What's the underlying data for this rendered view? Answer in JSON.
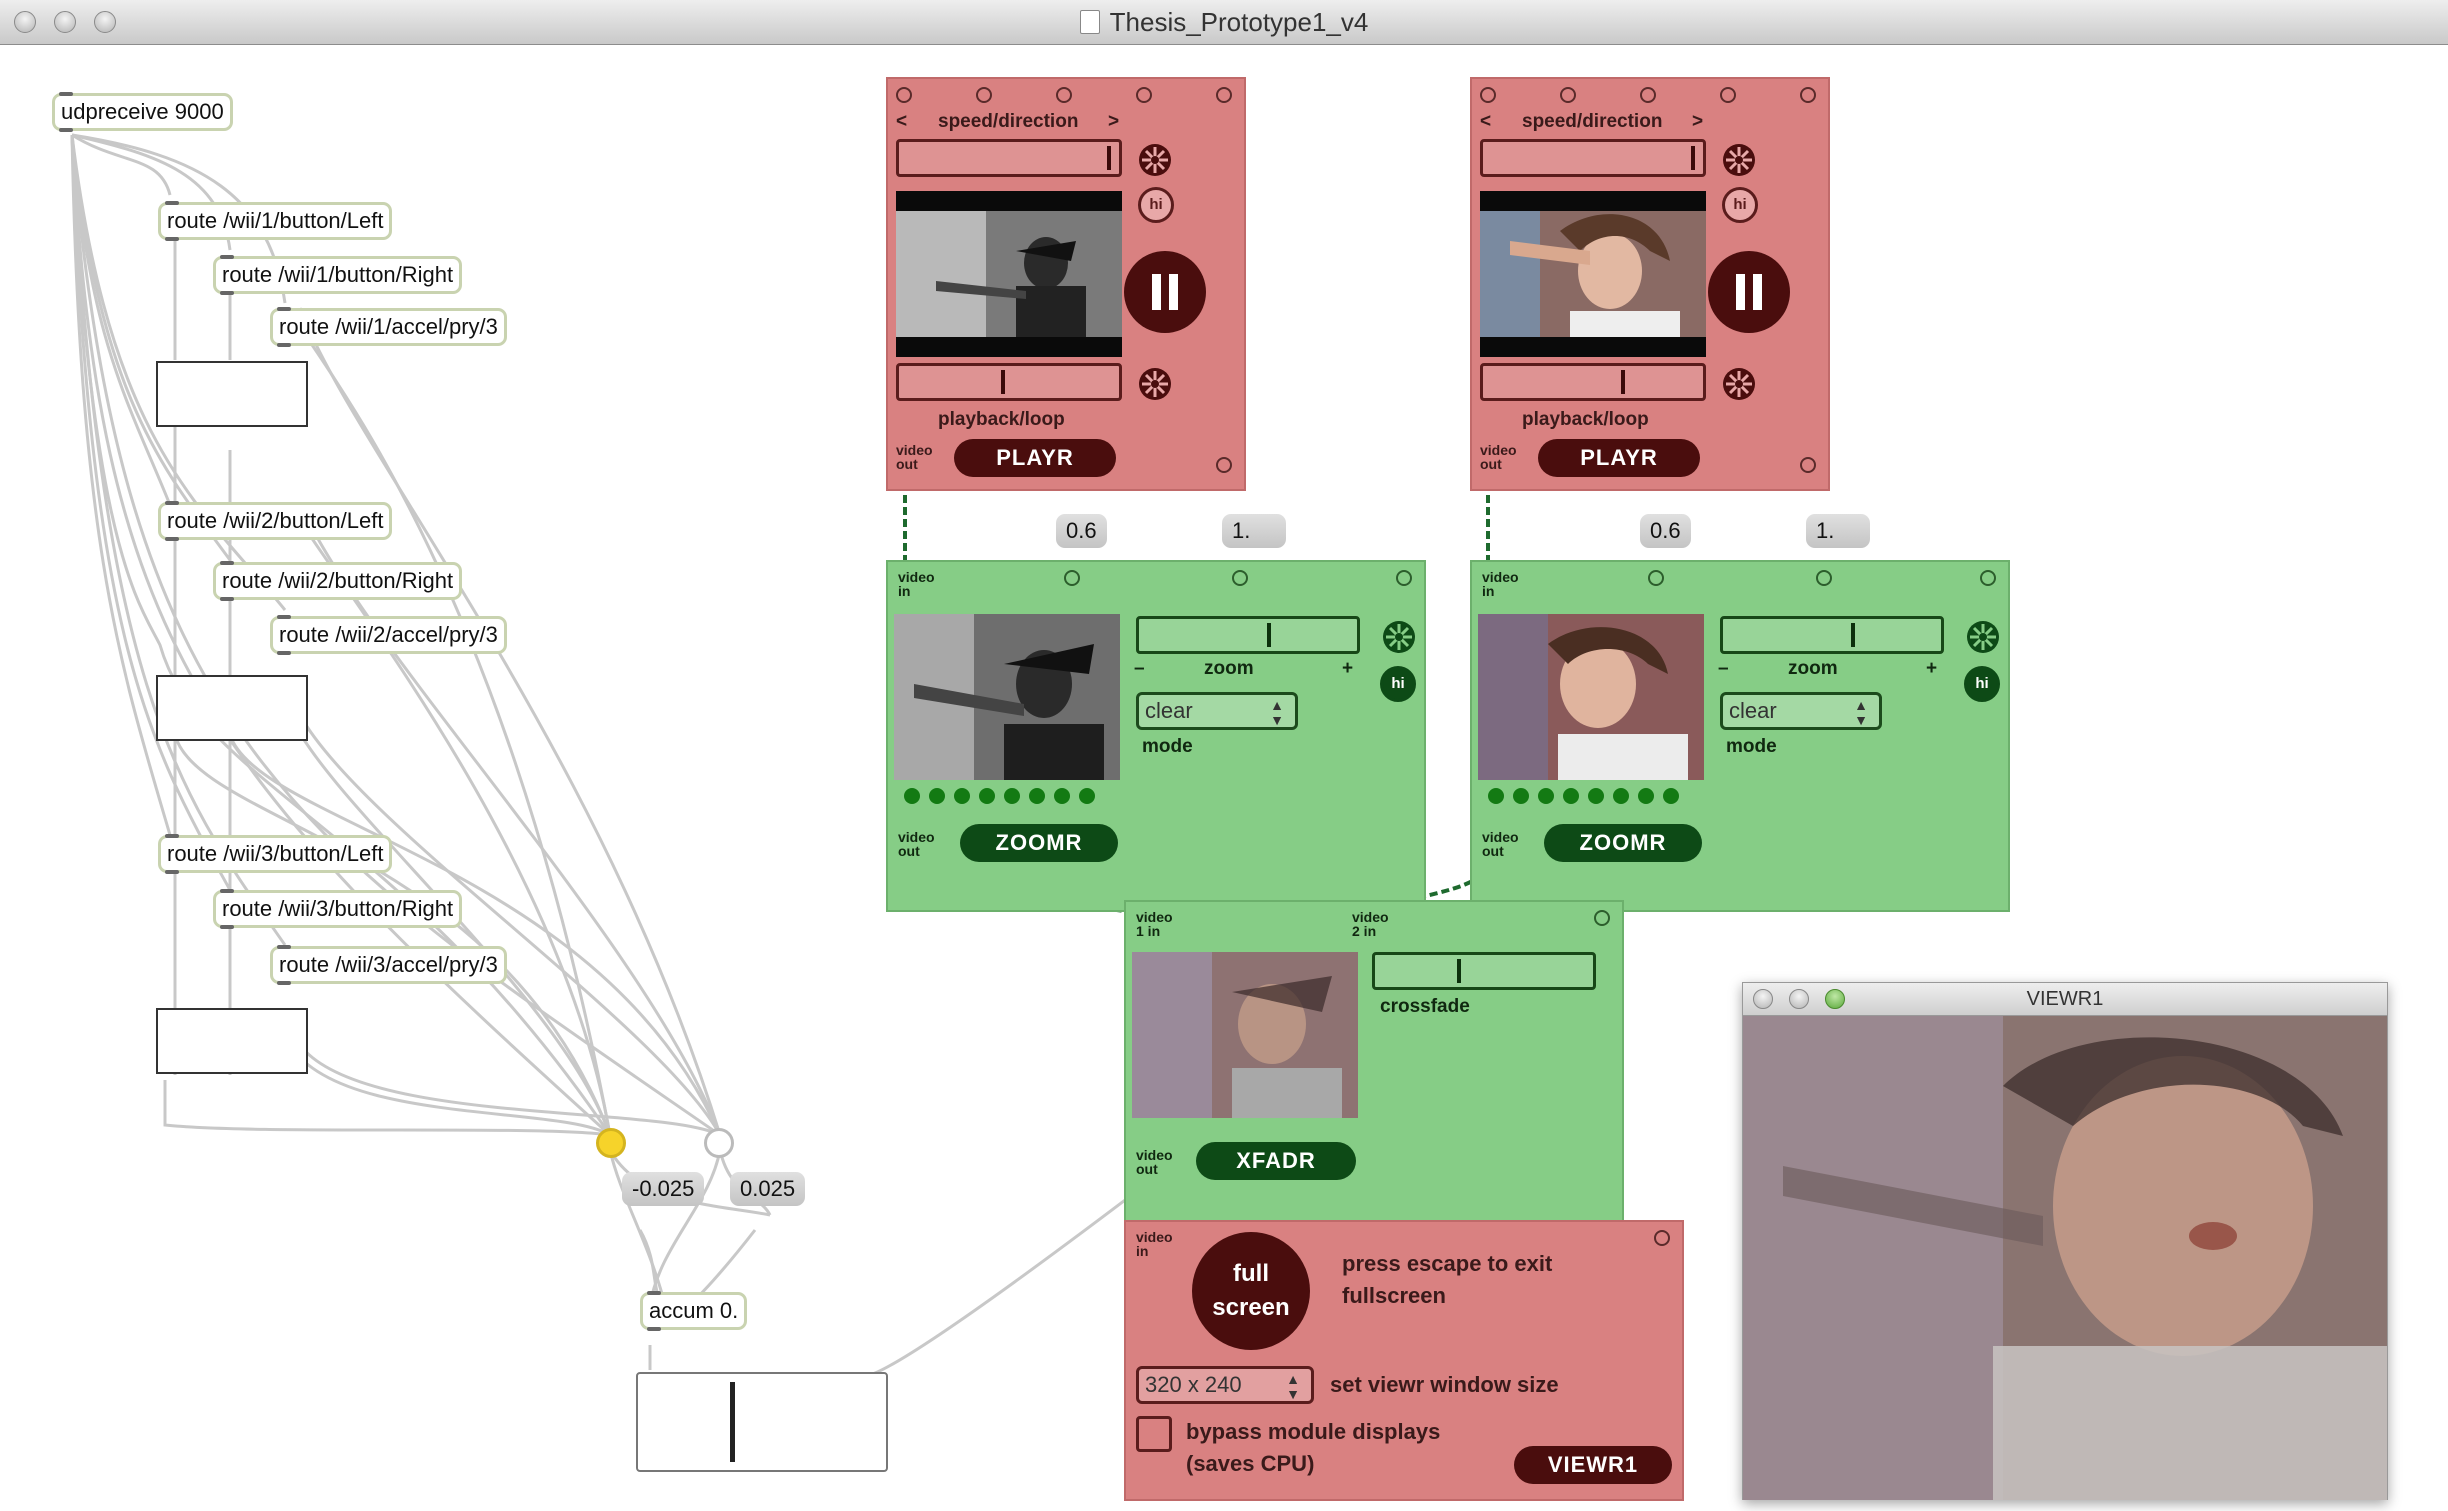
{
  "window": {
    "title": "Thesis_Prototype1_v4"
  },
  "objects": {
    "udp": "udpreceive 9000",
    "r1l": "route /wii/1/button/Left",
    "r1r": "route /wii/1/button/Right",
    "r1a": "route /wii/1/accel/pry/3",
    "r2l": "route /wii/2/button/Left",
    "r2r": "route /wii/2/button/Right",
    "r2a": "route /wii/2/accel/pry/3",
    "r3l": "route /wii/3/button/Left",
    "r3r": "route /wii/3/button/Right",
    "r3a": "route /wii/3/accel/pry/3",
    "accum": "accum 0."
  },
  "numbers": {
    "neg": "-0.025",
    "pos": "0.025",
    "z1a": "0.6",
    "z1b": "1.",
    "z2a": "0.6",
    "z2b": "1."
  },
  "toggles": {
    "left_on": true,
    "right_on": false
  },
  "playr": {
    "speed_label": "speed/direction",
    "less": "<",
    "more": ">",
    "hi": "hi",
    "playback_label": "playback/loop",
    "video_out": [
      "video",
      "out"
    ],
    "name": "PLAYR"
  },
  "zoomr": {
    "video_in": [
      "video",
      "in"
    ],
    "video_out": [
      "video",
      "out"
    ],
    "zoom_label": "zoom",
    "minus": "–",
    "plus": "+",
    "hi": "hi",
    "mode_value": "clear",
    "mode_label": "mode",
    "name": "ZOOMR"
  },
  "xfadr": {
    "in1": [
      "video",
      "1 in"
    ],
    "in2": [
      "video",
      "2 in"
    ],
    "crossfade_label": "crossfade",
    "video_out": [
      "video",
      "out"
    ],
    "name": "XFADR"
  },
  "viewr": {
    "video_in": [
      "video",
      "in"
    ],
    "full_screen": [
      "full",
      "screen"
    ],
    "escape_text": [
      "press escape to exit",
      "fullscreen"
    ],
    "size_value": "320 x 240",
    "size_label": "set viewr window size",
    "bypass_text": [
      "bypass module displays",
      "(saves CPU)"
    ],
    "name": "VIEWR1",
    "window_title": "VIEWR1"
  },
  "colors": {
    "red_module": "#d98181",
    "green_module": "#86cd86",
    "dark_red": "#4a0d0d",
    "dark_green": "#0d4a16",
    "toggle_on": "#f6d32a"
  }
}
